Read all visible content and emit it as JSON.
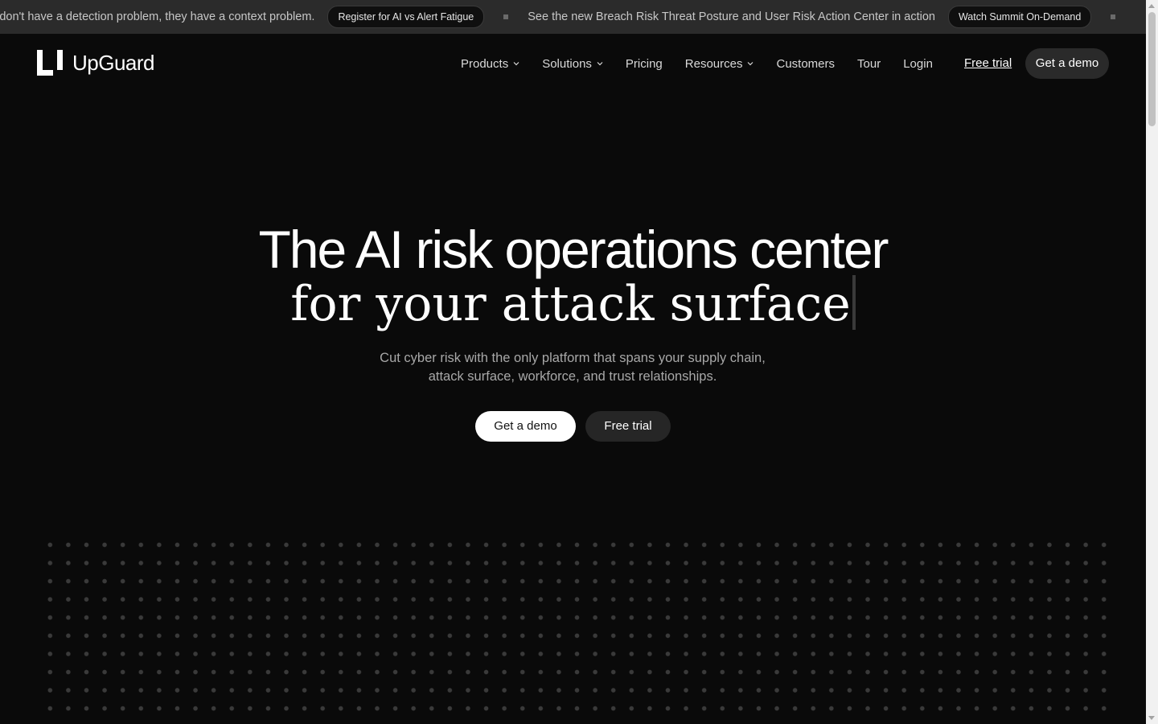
{
  "announcement": {
    "text_1": "ns don't have a detection problem, they have a context problem.",
    "pill_1": "Register for AI vs Alert Fatigue",
    "text_2": "See the new Breach Risk Threat Posture and User Risk Action Center in action",
    "pill_2": "Watch Summit On-Demand"
  },
  "header": {
    "logo_text": "UpGuard",
    "nav": [
      {
        "label": "Products",
        "has_dropdown": true
      },
      {
        "label": "Solutions",
        "has_dropdown": true
      },
      {
        "label": "Pricing",
        "has_dropdown": false
      },
      {
        "label": "Resources",
        "has_dropdown": true
      },
      {
        "label": "Customers",
        "has_dropdown": false
      },
      {
        "label": "Tour",
        "has_dropdown": false
      },
      {
        "label": "Login",
        "has_dropdown": false
      }
    ],
    "free_trial": "Free trial",
    "get_demo": "Get a demo"
  },
  "hero": {
    "title": "The AI risk operations center",
    "title_serif": "for your attack surface",
    "subtitle_line1": "Cut cyber risk with the only platform that spans your supply chain,",
    "subtitle_line2": "attack surface, workforce, and trust relationships.",
    "cta_primary": "Get a demo",
    "cta_secondary": "Free trial"
  },
  "colors": {
    "background": "#0a0a0a",
    "announcement_bg": "#2b2b2b",
    "primary_button": "#ffffff",
    "secondary_button": "#262626"
  }
}
